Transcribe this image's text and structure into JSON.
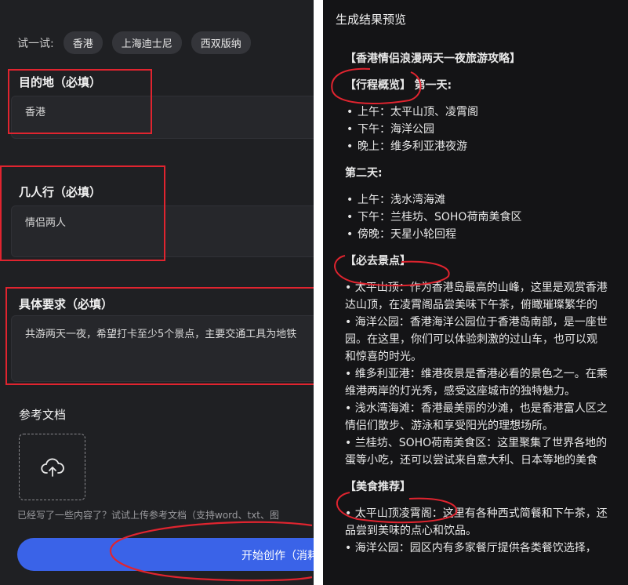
{
  "left": {
    "try_label": "试一试:",
    "chips": [
      "香港",
      "上海迪士尼",
      "西双版纳"
    ],
    "destination": {
      "label": "目的地（必填）",
      "value": "香港"
    },
    "travelers": {
      "label": "几人行（必填）",
      "value": "情侣两人"
    },
    "requirements": {
      "label": "具体要求（必填）",
      "value": "共游两天一夜，希望打卡至少5个景点，主要交通工具为地铁"
    },
    "reference": {
      "label": "参考文档"
    },
    "hint": "已经写了一些内容了？试试上传参考文档（支持word、txt、图",
    "start_button": "开始创作（消耗"
  },
  "right": {
    "title": "生成结果预览",
    "heading": "【香港情侣浪漫两天一夜旅游攻略】",
    "overview_tag": "【行程概览】",
    "day1": "第一天:",
    "day1_items": [
      "上午：太平山顶、凌霄阁",
      "下午：海洋公园",
      "晚上：维多利亚港夜游"
    ],
    "day2": "第二天:",
    "day2_items": [
      "上午：浅水湾海滩",
      "下午：兰桂坊、SOHO荷南美食区",
      "傍晚：天星小轮回程"
    ],
    "sights_tag": "【必去景点】",
    "sights_lines": [
      "• 太平山顶：作为香港岛最高的山峰，这里是观赏香港",
      "  达山顶，在凌霄阁品尝美味下午茶，俯瞰璀璨繁华的",
      "• 海洋公园：香港海洋公园位于香港岛南部，是一座世",
      "  园。在这里，你们可以体验刺激的过山车，也可以观",
      "  和惊喜的时光。",
      "• 维多利亚港：维港夜景是香港必看的景色之一。在乘",
      "  维港两岸的灯光秀，感受这座城市的独特魅力。",
      "• 浅水湾海滩：香港最美丽的沙滩，也是香港富人区之",
      "  情侣们散步、游泳和享受阳光的理想场所。",
      "• 兰桂坊、SOHO荷南美食区：这里聚集了世界各地的",
      "  蛋等小吃，还可以尝试来自意大利、日本等地的美食"
    ],
    "food_tag": "【美食推荐】",
    "food_lines": [
      "• 太平山顶凌霄阁：这里有各种西式简餐和下午茶，还",
      "  品尝到美味的点心和饮品。",
      "• 海洋公园：园区内有多家餐厅提供各类餐饮选择，"
    ]
  },
  "colors": {
    "accent": "#3a63e8",
    "annotation_red": "#e0242f"
  }
}
